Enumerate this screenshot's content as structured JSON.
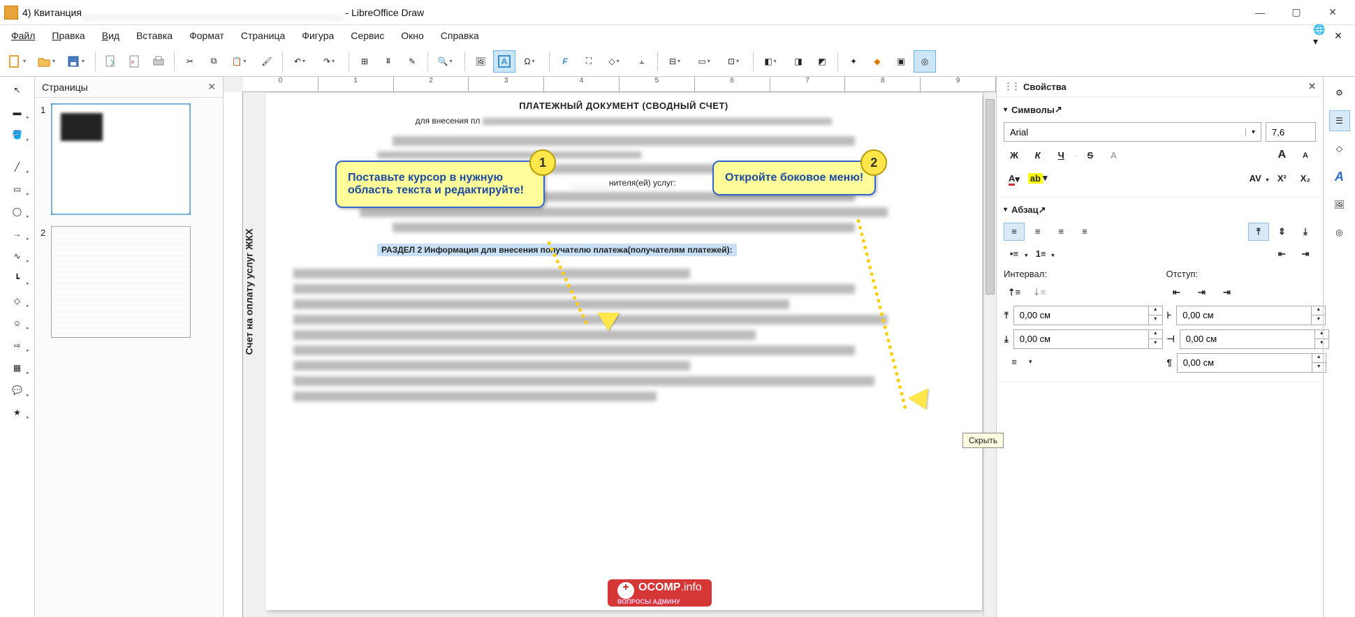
{
  "title": {
    "prefix": "4) Квитанция",
    "suffix": " - LibreOffice Draw"
  },
  "menu": [
    "Файл",
    "Правка",
    "Вид",
    "Вставка",
    "Формат",
    "Страница",
    "Фигура",
    "Сервис",
    "Окно",
    "Справка"
  ],
  "pages_panel": {
    "title": "Страницы",
    "page_numbers": [
      "1",
      "2"
    ]
  },
  "ruler_labels": [
    "0",
    "1",
    "2",
    "3",
    "4",
    "5",
    "6",
    "7",
    "8",
    "9"
  ],
  "vertical_label": "Счет на оплату услуг ЖКХ",
  "document": {
    "title": "ПЛАТЕЖНЫЙ ДОКУМЕНТ (СВОДНЫЙ СЧЕТ)",
    "sub": "для внесения пл",
    "services_label": "нителя(ей) услуг:",
    "section2": "РАЗДЕЛ  2 Информация для внесения получателю платежа(получателям платежей):"
  },
  "callouts": {
    "c1_num": "1",
    "c1_text": "Поставьте курсор в нужную область текста и редактируйте!",
    "c2_num": "2",
    "c2_text": "Откройте боковое меню!"
  },
  "tooltip": "Скрыть",
  "props": {
    "title": "Свойства",
    "sec_chars": "Символы",
    "sec_para": "Абзац",
    "font_name": "Arial",
    "font_size": "7,6",
    "bold": "Ж",
    "italic": "К",
    "underline": "Ч",
    "strike": "S",
    "shadow": "A",
    "font_color": "А",
    "highlight": "⎚",
    "spacing_label": "AV",
    "sup": "X²",
    "sub": "X₂",
    "kerning_big": "A",
    "kerning_small": "A",
    "align_left": "≡",
    "align_center": "≡",
    "align_right": "≡",
    "align_just": "≡",
    "valign_top": "⤒",
    "valign_mid": "⇕",
    "valign_bot": "⤓",
    "bullets": "•≡",
    "numbering": "1≡",
    "indent_dec": "⇤",
    "indent_inc": "⇥",
    "interval_label": "Интервал:",
    "indent_label": "Отступ:",
    "value_zero": "0,00 см"
  },
  "watermark": {
    "brand": "OCOMP",
    "tld": ".info",
    "sub": "ВОПРОСЫ АДМИНУ"
  }
}
